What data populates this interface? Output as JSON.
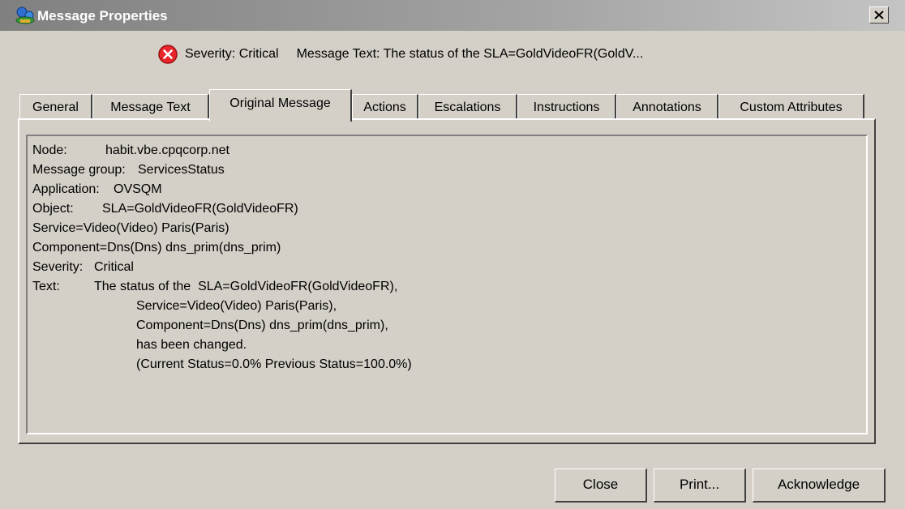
{
  "window": {
    "title": "Message Properties",
    "icon": "network-nodes-icon"
  },
  "summary": {
    "severity_label": "Severity:",
    "severity_value": "Critical",
    "message_label": "Message Text:",
    "message_value": "The status of the  SLA=GoldVideoFR(GoldV...",
    "severity_icon": "critical-x-icon",
    "severity_color": "#e8252a"
  },
  "tabs": [
    {
      "label": "General",
      "active": false
    },
    {
      "label": "Message Text",
      "active": false
    },
    {
      "label": "Original Message",
      "active": true
    },
    {
      "label": "Actions",
      "active": false
    },
    {
      "label": "Escalations",
      "active": false
    },
    {
      "label": "Instructions",
      "active": false
    },
    {
      "label": "Annotations",
      "active": false
    },
    {
      "label": "Custom Attributes",
      "active": false
    }
  ],
  "original_message": {
    "node_label": "Node:",
    "node_value": "habit.vbe.cpqcorp.net",
    "group_label": "Message group:",
    "group_value": "ServicesStatus",
    "app_label": "Application:",
    "app_value": "OVSQM",
    "object_label": "Object:",
    "object_value": "SLA=GoldVideoFR(GoldVideoFR)",
    "service_line": "Service=Video(Video) Paris(Paris)",
    "component_line": "Component=Dns(Dns) dns_prim(dns_prim)",
    "severity_label": "Severity:",
    "severity_value": "Critical",
    "text_label": "Text:",
    "text_lines": [
      "The status of the  SLA=GoldVideoFR(GoldVideoFR),",
      "Service=Video(Video) Paris(Paris),",
      "Component=Dns(Dns) dns_prim(dns_prim),",
      "has been changed.",
      "(Current Status=0.0% Previous Status=100.0%)"
    ]
  },
  "buttons": {
    "close": "Close",
    "print": "Print...",
    "acknowledge": "Acknowledge"
  }
}
